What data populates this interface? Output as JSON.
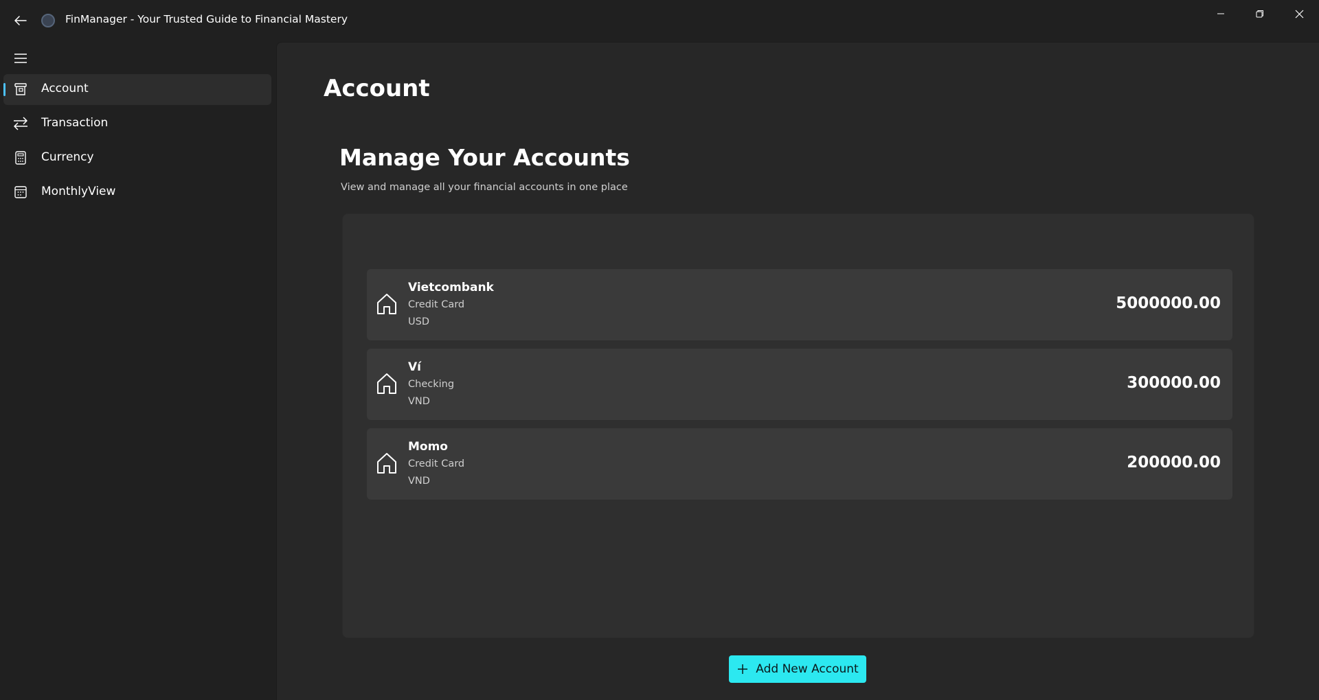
{
  "window": {
    "title": "FinManager - Your Trusted Guide to Financial Mastery",
    "back_icon": "back-arrow-icon",
    "app_icon": "app-logo-icon",
    "controls": [
      "minimize-icon",
      "restore-icon",
      "close-icon"
    ]
  },
  "sidebar": {
    "menu_icon": "hamburger-menu-icon",
    "items": [
      {
        "label": "Account",
        "icon": "account-register-icon",
        "active": true
      },
      {
        "label": "Transaction",
        "icon": "swap-arrows-icon",
        "active": false
      },
      {
        "label": "Currency",
        "icon": "calculator-icon",
        "active": false
      },
      {
        "label": "MonthlyView",
        "icon": "calendar-icon",
        "active": false
      }
    ]
  },
  "main": {
    "page_title": "Account",
    "section_heading": "Manage Your Accounts",
    "section_subtitle": "View and manage all your financial accounts in one place",
    "accounts": [
      {
        "name": "Vietcombank",
        "type": "Credit Card",
        "currency": "USD",
        "balance": "5000000.00",
        "icon": "home-icon"
      },
      {
        "name": "Ví",
        "type": "Checking",
        "currency": "VND",
        "balance": "300000.00",
        "icon": "home-icon"
      },
      {
        "name": "Momo",
        "type": "Credit Card",
        "currency": "VND",
        "balance": "200000.00",
        "icon": "home-icon"
      }
    ],
    "add_button": {
      "label": "Add New Account",
      "icon": "plus-icon"
    }
  },
  "colors": {
    "accent": "#2ce8f0",
    "nav_indicator": "#4cc2ff",
    "background": "#202020",
    "content_background": "#272727",
    "card_background": "#3a3a3a"
  }
}
